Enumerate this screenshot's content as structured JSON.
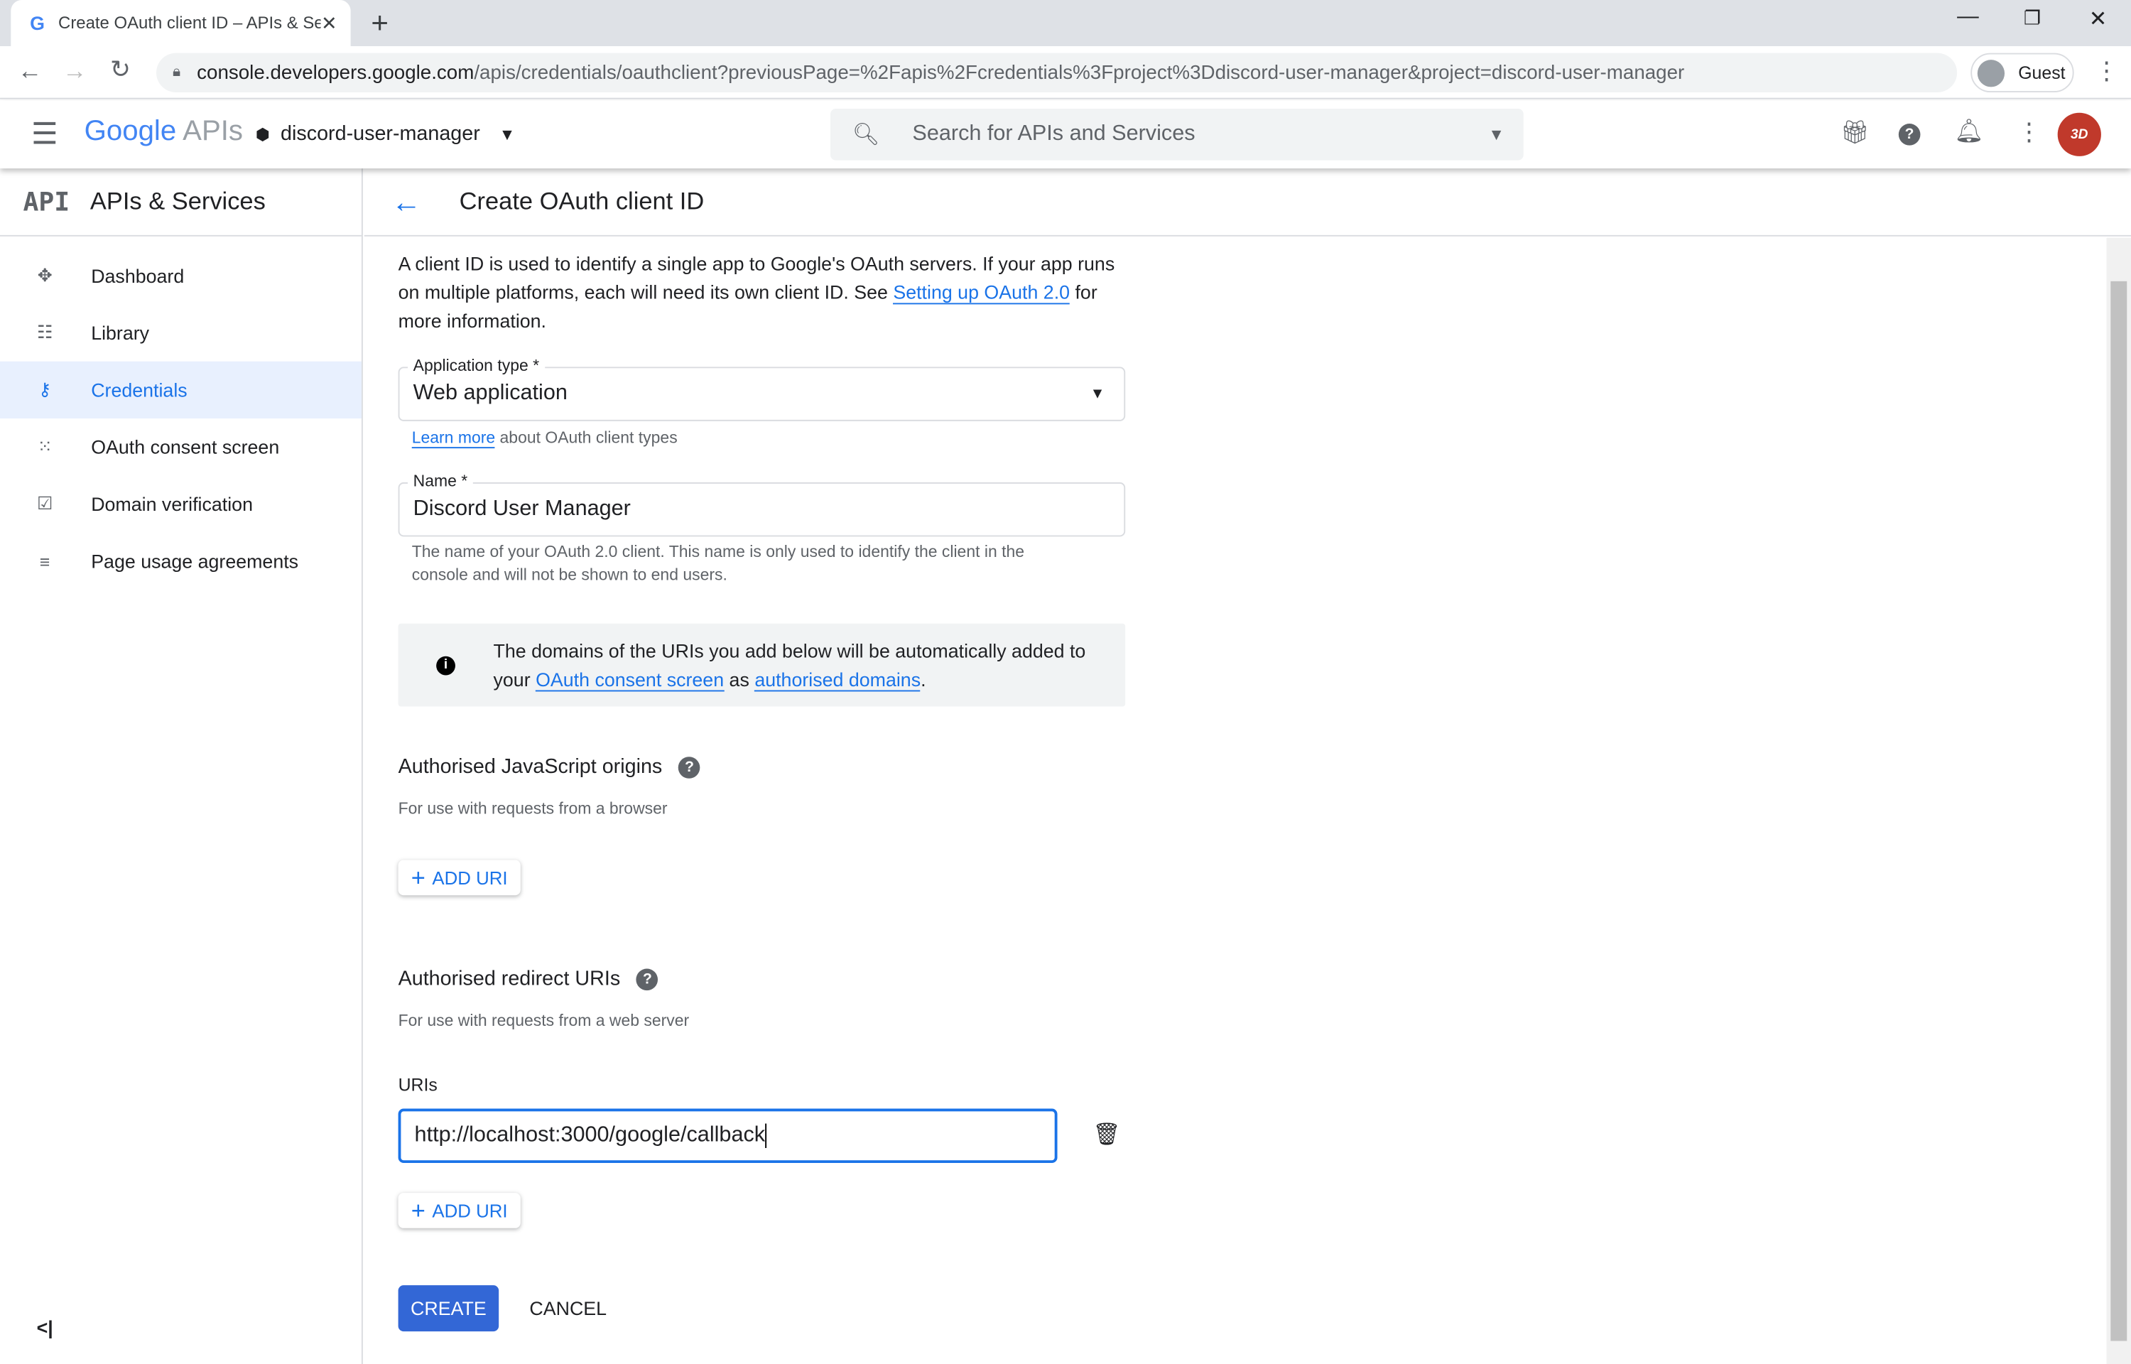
{
  "browser": {
    "tab_title": "Create OAuth client ID – APIs & Services",
    "url_host": "console.developers.google.com",
    "url_path": "/apis/credentials/oauthclient?previousPage=%2Fapis%2Fcredentials%3Fproject%3Ddiscord-user-manager&project=discord-user-manager",
    "profile": "Guest"
  },
  "header": {
    "logo": "Google APIs",
    "logo_google": "Google",
    "logo_apis": "APIs",
    "project": "discord-user-manager",
    "search_placeholder": "Search for APIs and Services"
  },
  "sidebar": {
    "logo": "API",
    "title": "APIs & Services",
    "items": [
      {
        "label": "Dashboard",
        "icon": "dashboard-icon"
      },
      {
        "label": "Library",
        "icon": "library-icon"
      },
      {
        "label": "Credentials",
        "icon": "key-icon",
        "selected": true
      },
      {
        "label": "OAuth consent screen",
        "icon": "consent-icon"
      },
      {
        "label": "Domain verification",
        "icon": "checkbox-icon"
      },
      {
        "label": "Page usage agreements",
        "icon": "settings-list-icon"
      }
    ]
  },
  "page": {
    "title": "Create OAuth client ID",
    "desc_1": "A client ID is used to identify a single app to Google's OAuth servers. If your app runs on multiple platforms, each will need its own client ID. See ",
    "desc_link": "Setting up OAuth 2.0",
    "desc_2": " for more information.",
    "app_type_label": "Application type *",
    "app_type_value": "Web application",
    "learn_more": "Learn more",
    "learn_more_rest": " about OAuth client types",
    "name_label": "Name *",
    "name_value": "Discord User Manager",
    "name_hint": "The name of your OAuth 2.0 client. This name is only used to identify the client in the console and will not be shown to end users.",
    "note_1": "The domains of the URIs you add below will be automatically added to your ",
    "note_link1": "OAuth consent screen",
    "note_2": " as ",
    "note_link2": "authorised domains",
    "note_3": ".",
    "js_title": "Authorised JavaScript origins",
    "js_sub": "For use with requests from a browser",
    "add_uri": "ADD URI",
    "redir_title": "Authorised redirect URIs",
    "redir_sub": "For use with requests from a web server",
    "uris_label": "URIs",
    "uri_value": "http://localhost:3000/google/callback",
    "create": "CREATE",
    "cancel": "CANCEL"
  },
  "colors": {
    "accent": "#1a73e8",
    "create_button": "#3367d6"
  }
}
